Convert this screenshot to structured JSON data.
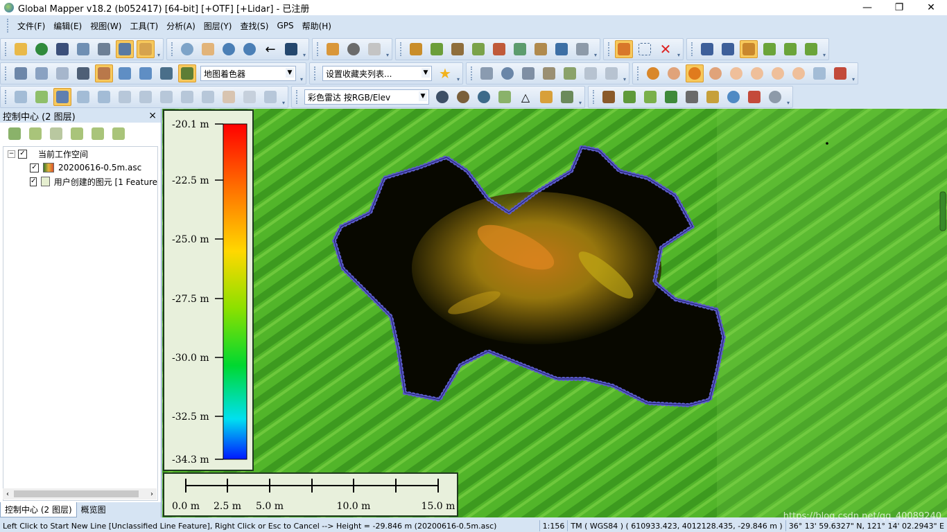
{
  "title": "Global Mapper v18.2 (b052417) [64-bit] [+OTF] [+Lidar] - 已注册",
  "window_controls": [
    "—",
    "❐",
    "✕"
  ],
  "menu": [
    "文件(F)",
    "编辑(E)",
    "视图(W)",
    "工具(T)",
    "分析(A)",
    "图层(Y)",
    "查找(S)",
    "GPS",
    "帮助(H)"
  ],
  "toolbar": {
    "shader_dropdown": "地图着色器",
    "favorites_dropdown": "设置收藏夹列表...",
    "radar_dropdown": "彩色雷达 按RGB/Elev"
  },
  "panel": {
    "title": "控制中心 (2 图层)",
    "close": "×",
    "tree": {
      "workspace": "当前工作空间",
      "layers": [
        "20200616-0.5m.asc",
        "用户创建的图元 [1 Feature"
      ]
    },
    "tabs": [
      "控制中心 (2 图层)",
      "概览图"
    ]
  },
  "legend": {
    "labels": [
      "-20.1 m",
      "-22.5 m",
      "-25.0 m",
      "-27.5 m",
      "-30.0 m",
      "-32.5 m",
      "-34.3 m"
    ]
  },
  "scalebar": {
    "labels": [
      "0.0 m",
      "2.5 m",
      "5.0 m",
      "10.0 m",
      "15.0 m"
    ]
  },
  "status": {
    "message": "Left Click to Start New Line [Unclassified Line Feature], Right Click or Esc to Cancel --> Height = -29.846 m (20200616-0.5m.asc)",
    "scale": "1:156",
    "projection": "TM ( WGS84 ) ( 610933.423, 4012128.435, -29.846 m )",
    "coords": "36° 13' 59.6327\" N, 121° 14' 02.2943\" E"
  },
  "watermark": "https://blog.csdn.net/qq_40089240",
  "colors": {
    "accent": "#f7c95c",
    "chrome": "#d6e4f3",
    "terrain": "#55b72a"
  }
}
